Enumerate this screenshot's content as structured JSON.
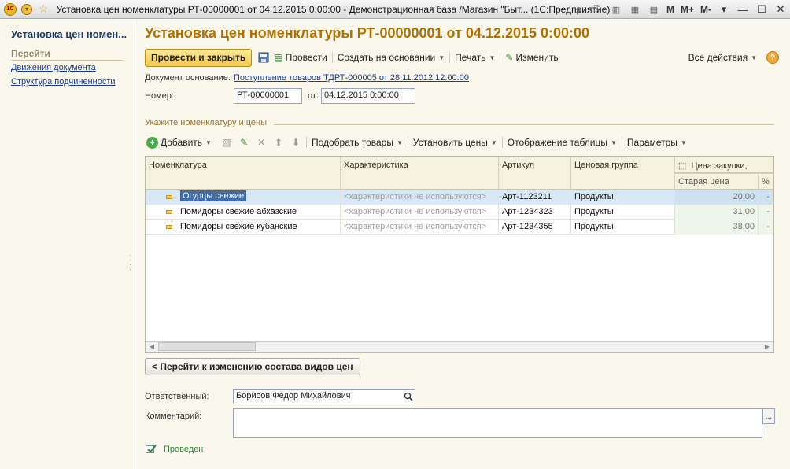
{
  "window": {
    "title": "Установка цен номенклатуры РТ-00000001 от 04.12.2015 0:00:00 - Демонстрационная база /Магазин \"Быт... (1С:Предприятие)",
    "logo_text": "1С",
    "tools": {
      "m": "M",
      "m_plus": "M+",
      "m_minus": "M-"
    }
  },
  "sidebar": {
    "title": "Установка цен номен...",
    "section": "Перейти",
    "links": [
      "Движения документа",
      "Структура подчиненности"
    ]
  },
  "document": {
    "title": "Установка цен номенклатуры РТ-00000001 от 04.12.2015 0:00:00",
    "commands": {
      "post_close": "Провести и закрыть",
      "post": "Провести",
      "create_based": "Создать на основании",
      "print": "Печать",
      "edit": "Изменить",
      "all_actions": "Все действия",
      "help": "?"
    },
    "base_label": "Документ основание:",
    "base_link": "Поступление товаров ТДРТ-000005 от 28.11.2012 12:00:00",
    "number_label": "Номер:",
    "number_value": "РТ-00000001",
    "date_label": "от:",
    "date_value": "04.12.2015  0:00:00"
  },
  "items_group": {
    "label": "Укажите номенклатуру и цены",
    "toolbar": {
      "add": "Добавить",
      "pick": "Подобрать товары",
      "set_prices": "Установить цены",
      "table_view": "Отображение таблицы",
      "params": "Параметры"
    },
    "columns": {
      "nomenclature": "Номенклатура",
      "characteristic": "Характеристика",
      "article": "Артикул",
      "price_group": "Ценовая группа",
      "purchase_price": "Цена закупки,",
      "old_price": "Старая цена",
      "percent": "%"
    },
    "rows": [
      {
        "name": "Огурцы свежие",
        "characteristic": "<характеристики не используются>",
        "article": "Арт-1123211",
        "group": "Продукты",
        "old_price": "20,00",
        "pct": "-"
      },
      {
        "name": "Помидоры свежие абхазские",
        "characteristic": "<характеристики не используются>",
        "article": "Арт-1234323",
        "group": "Продукты",
        "old_price": "31,00",
        "pct": "-"
      },
      {
        "name": "Помидоры свежие кубанские",
        "characteristic": "<характеристики не используются>",
        "article": "Арт-1234355",
        "group": "Продукты",
        "old_price": "38,00",
        "pct": "-"
      }
    ]
  },
  "nav_button": "< Перейти к изменению состава видов цен",
  "responsible": {
    "label": "Ответственный:",
    "value": "Борисов Федор Михайлович"
  },
  "comment": {
    "label": "Комментарий:",
    "value": "",
    "button": "..."
  },
  "status": "Проведен",
  "colors": {
    "accent": "#b07000",
    "link": "#1a3c9e",
    "panel_bg": "#faf8ec",
    "selection": "#d8e8f6",
    "posted": "#2c8a3a"
  }
}
